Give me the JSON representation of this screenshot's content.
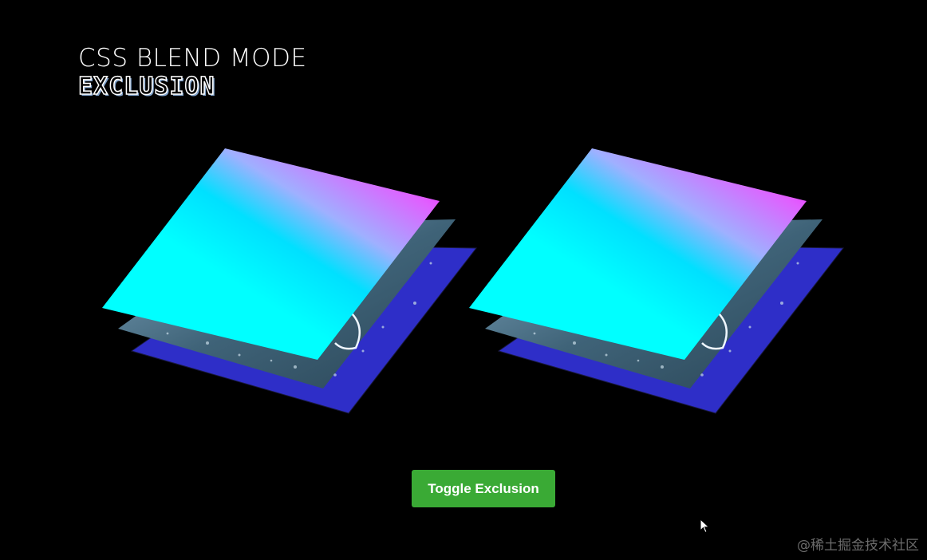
{
  "header": {
    "title": "CSS BLEND MODE",
    "mode_name": "EXCLUSION"
  },
  "stacks": [
    {
      "name": "left",
      "layers": [
        "gradient",
        "water-photo",
        "blue"
      ]
    },
    {
      "name": "right",
      "layers": [
        "gradient",
        "water-photo",
        "blue"
      ]
    }
  ],
  "colors": {
    "background": "#000000",
    "gradient_start": "#00ffff",
    "gradient_end": "#ff00ff",
    "blue_layer": "#2e2ec8",
    "water_layer": "#4a7088",
    "button": "#3aaa35"
  },
  "toggle_button": {
    "label": "Toggle Exclusion"
  },
  "cursor": {
    "icon": "mouse-pointer-icon"
  },
  "watermark": {
    "text": "@稀土掘金技术社区"
  }
}
